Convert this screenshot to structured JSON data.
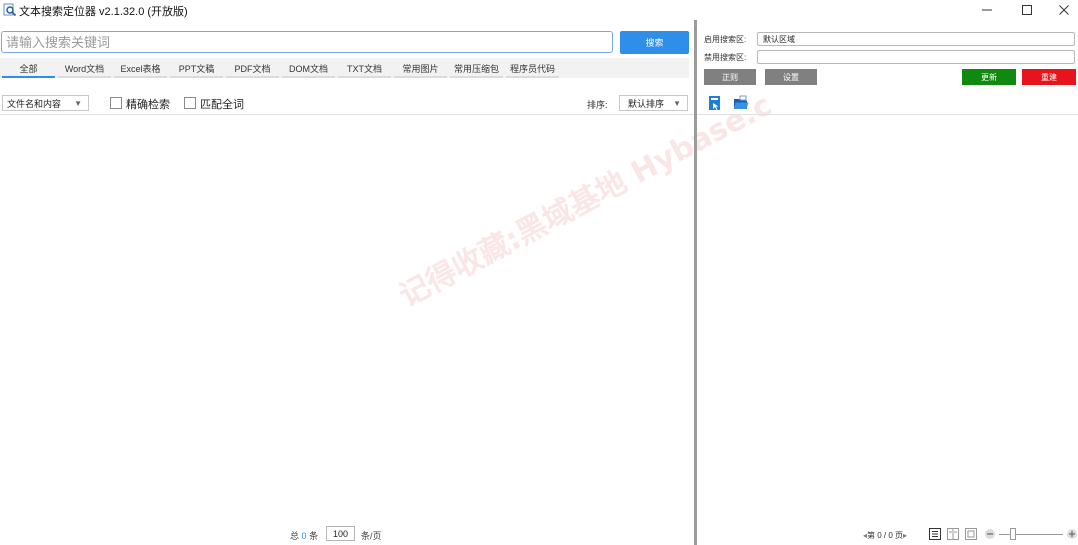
{
  "window": {
    "title": "文本搜索定位器 v2.1.32.0 (开放版)",
    "min_icon": "minimize-icon",
    "max_icon": "maximize-icon",
    "close_icon": "close-icon"
  },
  "search": {
    "placeholder": "请输入搜索关键词",
    "button_label": "搜索"
  },
  "tabs": [
    {
      "label": "全部",
      "active": true
    },
    {
      "label": "Word文档",
      "active": false
    },
    {
      "label": "Excel表格",
      "active": false
    },
    {
      "label": "PPT文稿",
      "active": false
    },
    {
      "label": "PDF文档",
      "active": false
    },
    {
      "label": "DOM文档",
      "active": false
    },
    {
      "label": "TXT文档",
      "active": false
    },
    {
      "label": "常用图片",
      "active": false
    },
    {
      "label": "常用压缩包",
      "active": false
    },
    {
      "label": "程序员代码",
      "active": false
    }
  ],
  "filters": {
    "scope_value": "文件名和内容",
    "exact_search_label": "精确检索",
    "exact_search_checked": false,
    "whole_word_label": "匹配全词",
    "whole_word_checked": false,
    "sort_label": "排序:",
    "sort_value": "默认排序"
  },
  "watermark": "记得收藏:黑域基地 Hybase.c",
  "pager": {
    "total_prefix": "总",
    "total_count": "0",
    "total_suffix": "条",
    "page_size": "100",
    "page_unit": "条/页"
  },
  "right_panel": {
    "enabled_area_label": "启用搜索区:",
    "enabled_area_value": "默认区域",
    "disabled_area_label": "禁用搜索区:",
    "disabled_area_value": "",
    "regex_label": "正则",
    "settings_label": "设置",
    "update_label": "更新",
    "rebuild_label": "重建"
  },
  "preview": {
    "page_indicator": "第 0 / 0 页"
  },
  "colors": {
    "accent": "#2f8fe8",
    "update": "#0f8a0f",
    "rebuild": "#e8141c",
    "neutral_button": "#808080"
  }
}
